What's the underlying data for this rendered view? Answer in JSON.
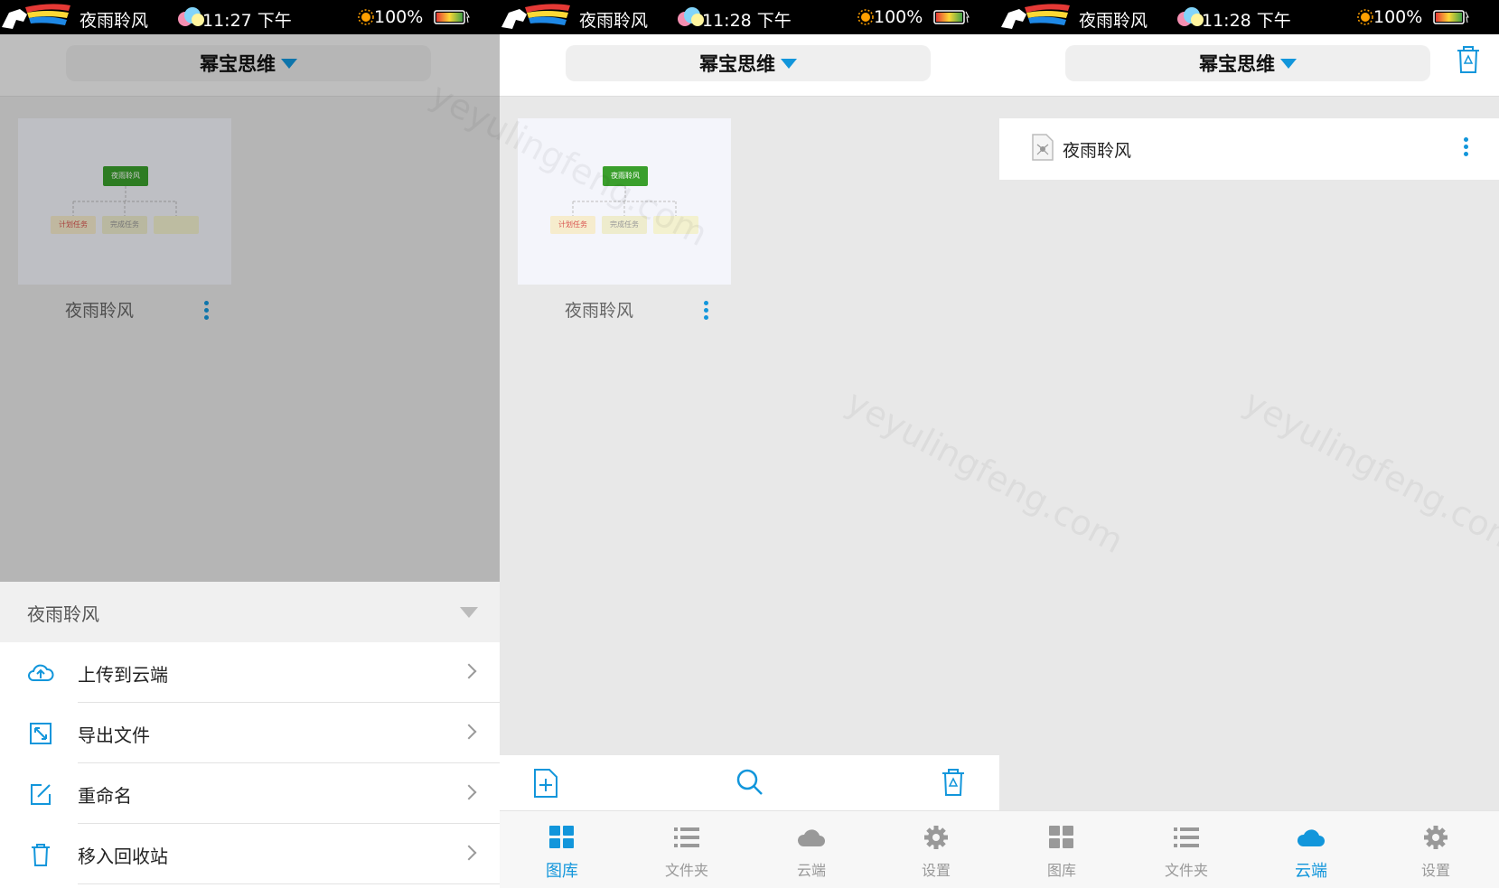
{
  "status_bars": [
    {
      "name": "夜雨聆风",
      "time": "11:27 下午",
      "battery": "100%"
    },
    {
      "name": "夜雨聆风",
      "time": "11:28 下午",
      "battery": "100%"
    },
    {
      "name": "夜雨聆风",
      "time": "11:28 下午",
      "battery": "100%"
    }
  ],
  "app_title": "幂宝思维",
  "file_name": "夜雨聆风",
  "mindmap": {
    "root": "夜雨聆风",
    "children": [
      "计划任务",
      "完成任务",
      ""
    ]
  },
  "menu": {
    "header": "夜雨聆风",
    "items": [
      {
        "label": "上传到云端",
        "icon": "cloud-upload-icon"
      },
      {
        "label": "导出文件",
        "icon": "export-icon"
      },
      {
        "label": "重命名",
        "icon": "edit-icon"
      },
      {
        "label": "移入回收站",
        "icon": "trash-icon"
      }
    ]
  },
  "tabs": [
    {
      "label": "图库",
      "icon": "grid-icon"
    },
    {
      "label": "文件夹",
      "icon": "list-icon"
    },
    {
      "label": "云端",
      "icon": "cloud-icon"
    },
    {
      "label": "设置",
      "icon": "gear-icon"
    }
  ],
  "active_tab_panel2": "图库",
  "active_tab_panel3": "云端",
  "watermark": "yeyulingfeng.com",
  "colors": {
    "accent": "#1296db",
    "root_node": "#3a9f2c"
  }
}
